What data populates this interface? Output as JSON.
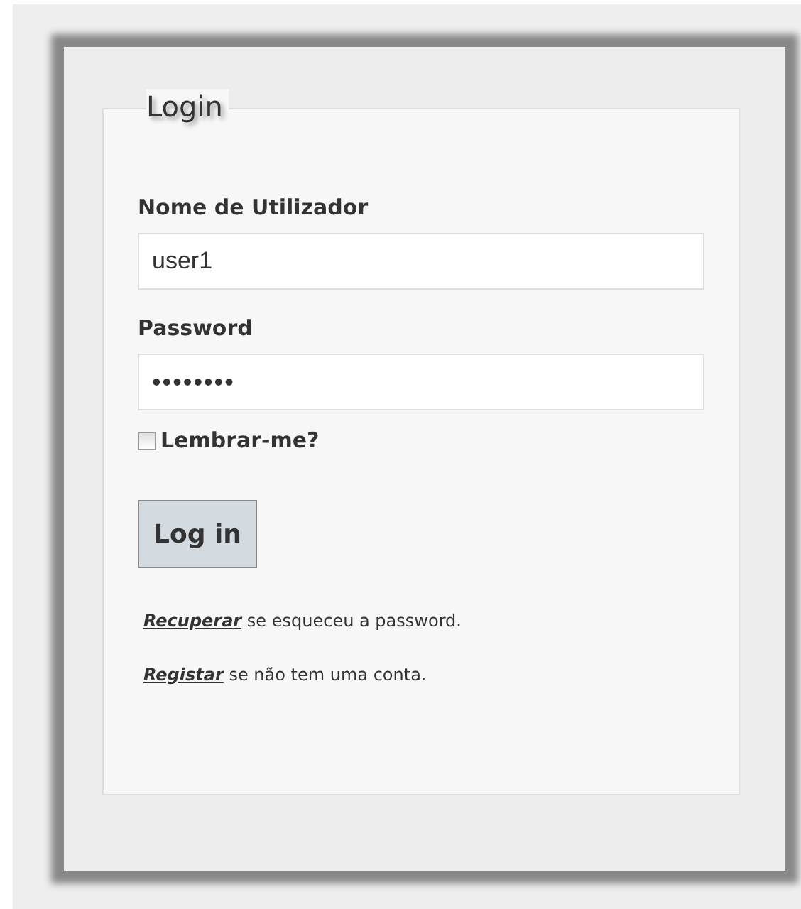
{
  "form": {
    "legend": "Login",
    "fields": [
      {
        "label": "Nome de Utilizador",
        "value": "user1",
        "kind": "text"
      },
      {
        "label": "Password",
        "value": "••••••••",
        "kind": "password"
      }
    ],
    "remember": {
      "label": "Lembrar-me?",
      "checked": false
    },
    "submit": "Log in",
    "links": [
      {
        "link": "Recuperar",
        "text": " se esqueceu a password."
      },
      {
        "link": "Registar",
        "text": " se não tem uma conta."
      }
    ]
  }
}
